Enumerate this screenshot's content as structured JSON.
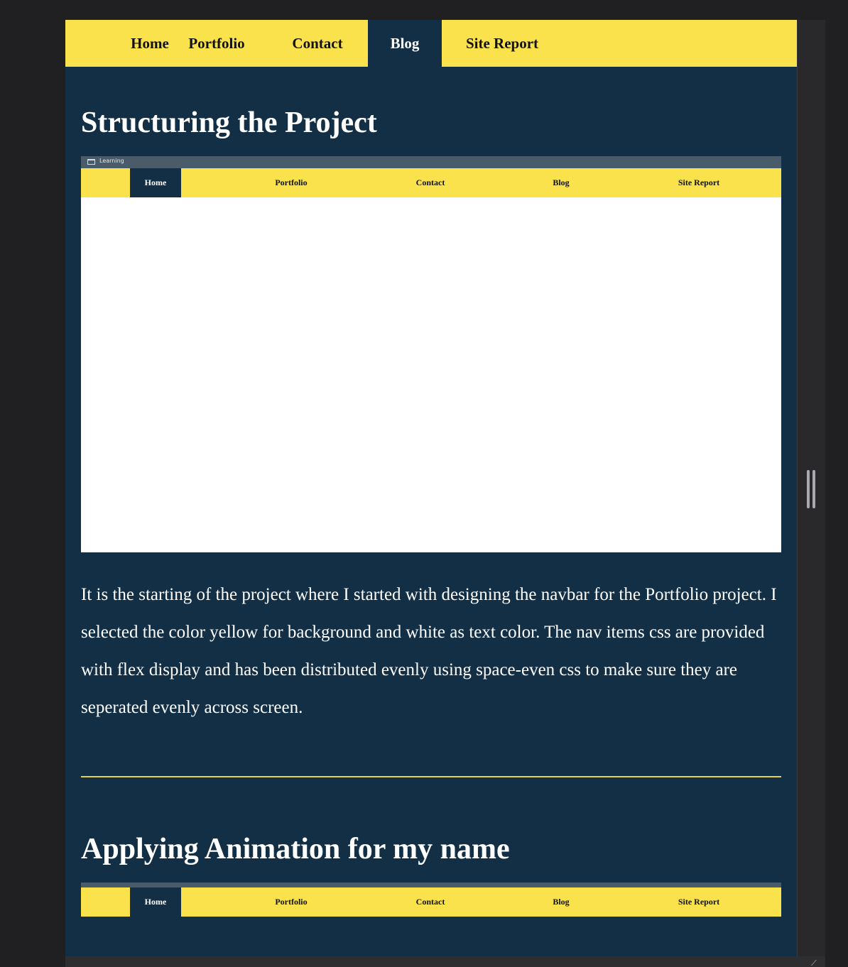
{
  "nav": {
    "items": [
      {
        "label": "Home",
        "active": false
      },
      {
        "label": "Portfolio",
        "active": false
      },
      {
        "label": "Contact",
        "active": false
      },
      {
        "label": "Blog",
        "active": true
      },
      {
        "label": "Site Report",
        "active": false
      }
    ]
  },
  "posts": [
    {
      "title": "Structuring the Project",
      "image": {
        "tab_label": "Learning",
        "nav_items": [
          "Home",
          "Portfolio",
          "Contact",
          "Blog",
          "Site Report"
        ],
        "active_item": "Home"
      },
      "text": "It is the starting of the project where I started with designing the navbar for the Portfolio project. I selected the color yellow for background and white as text color. The nav items css are provided with flex display and has been distributed evenly using space-even css to make sure they are seperated evenly across screen."
    },
    {
      "title": "Applying Animation for my name",
      "image": {
        "nav_items": [
          "Home",
          "Portfolio",
          "Contact",
          "Blog",
          "Site Report"
        ],
        "active_item": "Home"
      }
    }
  ],
  "colors": {
    "nav_background": "#f9e24b",
    "page_background": "#132f45",
    "divider": "#e8cf45",
    "text": "#ffffff"
  }
}
